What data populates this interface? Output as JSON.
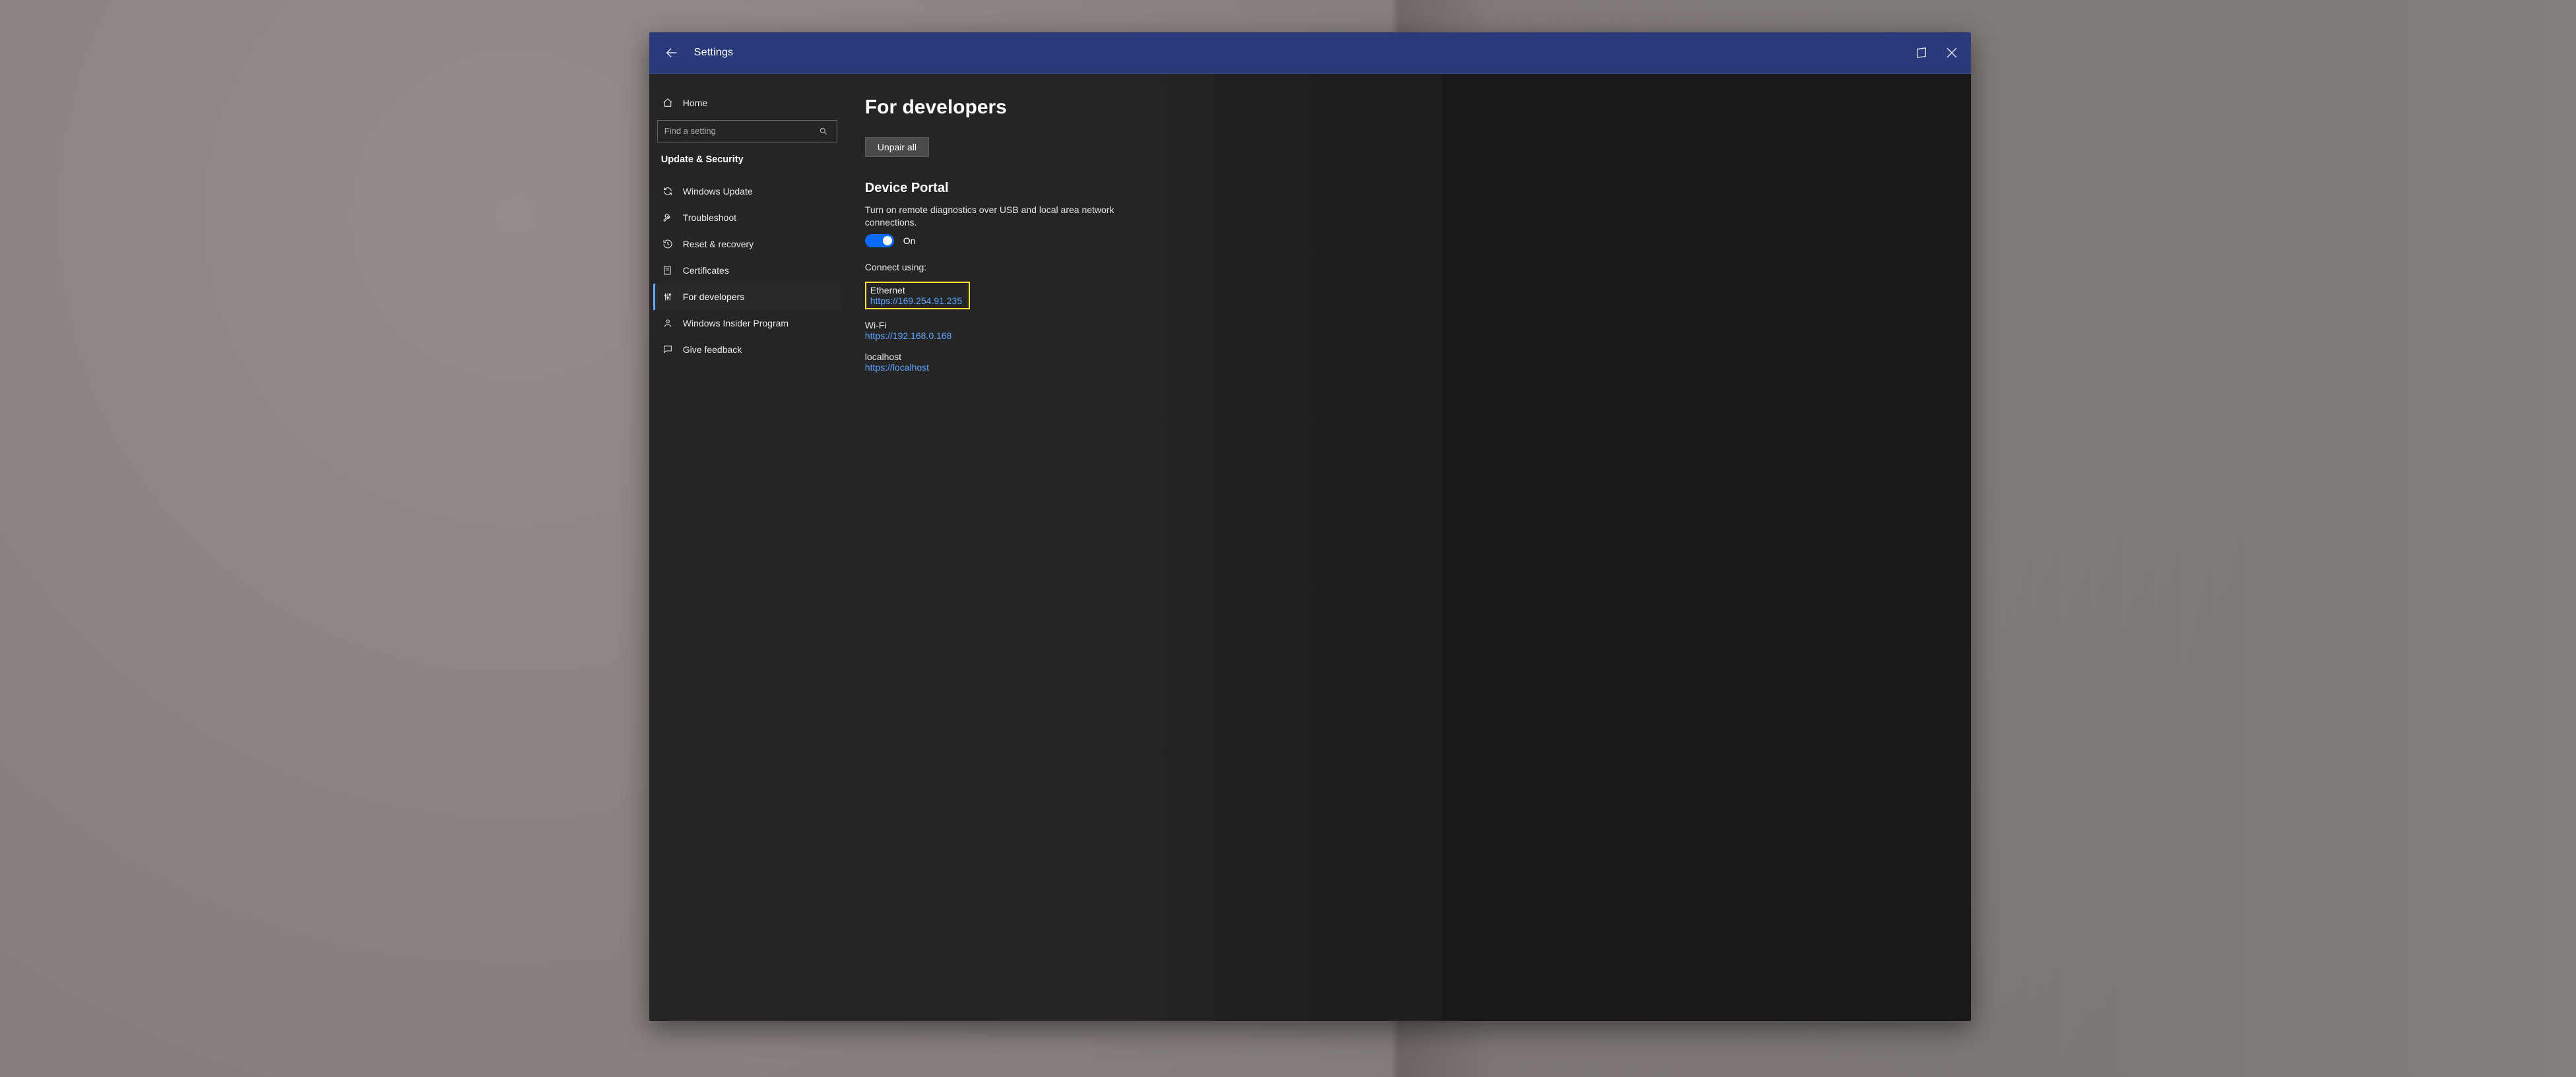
{
  "titlebar": {
    "title": "Settings"
  },
  "sidebar": {
    "home_label": "Home",
    "search_placeholder": "Find a setting",
    "section_title": "Update & Security",
    "items": [
      {
        "label": "Windows Update"
      },
      {
        "label": "Troubleshoot"
      },
      {
        "label": "Reset & recovery"
      },
      {
        "label": "Certificates"
      },
      {
        "label": "For developers"
      },
      {
        "label": "Windows Insider Program"
      },
      {
        "label": "Give feedback"
      }
    ]
  },
  "main": {
    "page_heading": "For developers",
    "unpair_label": "Unpair all",
    "device_portal_heading": "Device Portal",
    "device_portal_desc": "Turn on remote diagnostics over USB and local area network connections.",
    "toggle_state_label": "On",
    "connect_using_label": "Connect using:",
    "ethernet": {
      "label": "Ethernet",
      "url": "https://169.254.91.235"
    },
    "wifi": {
      "label": "Wi-Fi",
      "url": "https://192.168.0.168"
    },
    "localhost": {
      "label": "localhost",
      "url": "https://localhost"
    }
  }
}
